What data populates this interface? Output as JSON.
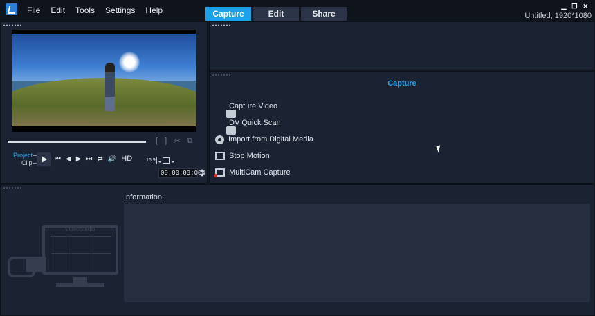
{
  "menu": {
    "items": [
      "File",
      "Edit",
      "Tools",
      "Settings",
      "Help"
    ]
  },
  "tabs": [
    {
      "label": "Capture",
      "active": true
    },
    {
      "label": "Edit",
      "active": false
    },
    {
      "label": "Share",
      "active": false
    }
  ],
  "document": {
    "info": "Untitled, 1920*1080"
  },
  "player": {
    "project_label": "Project",
    "clip_label": "Clip",
    "hd_label": "HD",
    "aspect_label": "16:9",
    "timecode": "00:00:03:004",
    "trim_icons": [
      "[",
      "]"
    ]
  },
  "capture": {
    "title": "Capture",
    "options": [
      {
        "label": "Capture Video",
        "icon": "camera-icon"
      },
      {
        "label": "DV Quick Scan",
        "icon": "dv-scan-icon"
      },
      {
        "label": "Import from Digital Media",
        "icon": "disc-icon"
      },
      {
        "label": "Stop Motion",
        "icon": "stop-motion-icon"
      },
      {
        "label": "MultiCam Capture",
        "icon": "multicam-icon"
      }
    ]
  },
  "info": {
    "label": "Information:"
  },
  "watermark": {
    "title": "VideoStudio"
  },
  "colors": {
    "accent": "#1aa1e8",
    "panel": "#1b2232",
    "background": "#111722",
    "record": "#e0242d"
  }
}
